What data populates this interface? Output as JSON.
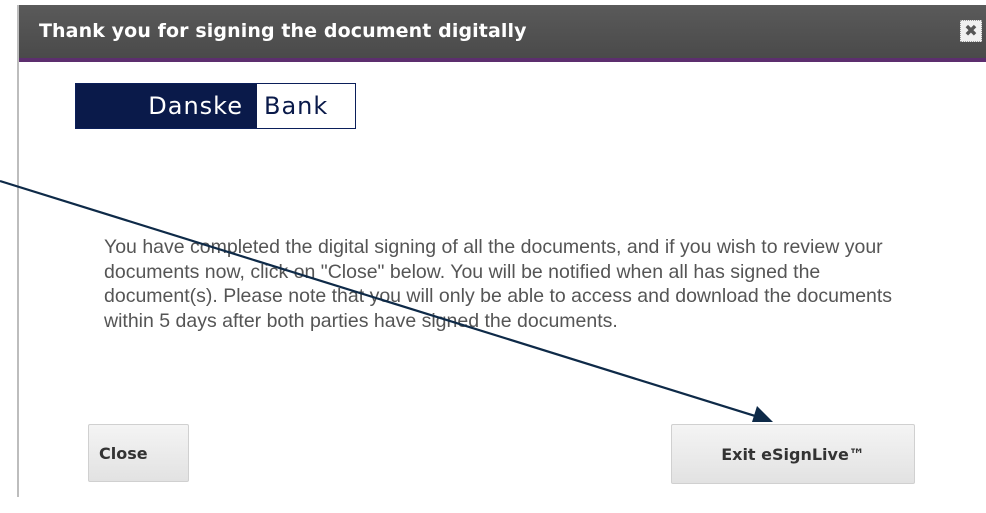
{
  "dialog": {
    "title": "Thank you for signing the document digitally",
    "close_icon_glyph": "✖",
    "message": "You have completed the digital signing of all the documents, and if you wish to review your documents now, click on \"Close\" below. You will be notified when all has signed the document(s). Please note that you will only be able to access and download the documents within 5 days after both parties have signed the documents.",
    "buttons": {
      "close_label": "Close",
      "exit_label": "Exit eSignLive™"
    }
  },
  "logo": {
    "left_text": "Danske",
    "right_text": "Bank"
  },
  "colors": {
    "titlebar": "#4f4f4f",
    "titlebar_accent": "#5c2e6e",
    "brand_navy": "#0a1a4a",
    "arrow": "#0e2a48"
  },
  "icons": {
    "close": "close-icon",
    "annotation": "arrow-icon"
  }
}
